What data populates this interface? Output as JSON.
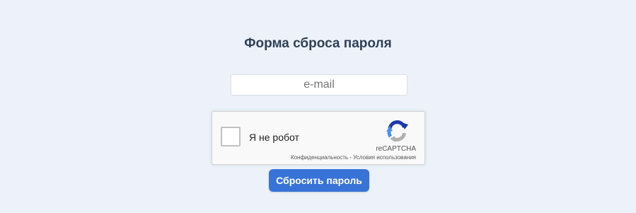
{
  "form": {
    "title": "Форма сброса пароля",
    "email_placeholder": "e-mail",
    "email_value": "",
    "submit_label": "Сбросить пароль"
  },
  "recaptcha": {
    "label": "Я не робот",
    "brand": "reCAPTCHA",
    "privacy_link": "Конфиденциальность",
    "separator": " - ",
    "terms_link": "Условия использования",
    "logo_icon": "recaptcha-logo-icon"
  },
  "colors": {
    "background": "#edf2fa",
    "title": "#2f4057",
    "button": "#3874d8",
    "button_text": "#ffffff"
  }
}
